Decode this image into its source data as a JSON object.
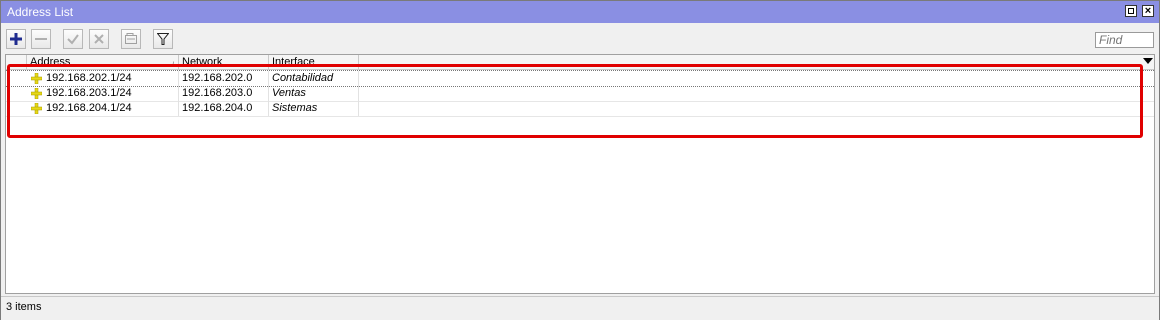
{
  "window": {
    "title": "Address List",
    "controls": [
      "restore-icon",
      "close-icon"
    ]
  },
  "toolbar": {
    "buttons": [
      {
        "name": "add-icon",
        "enabled": true
      },
      {
        "name": "remove-icon",
        "enabled": false
      },
      {
        "name": "enable-icon",
        "enabled": false
      },
      {
        "name": "disable-icon",
        "enabled": false
      },
      {
        "name": "comment-icon",
        "enabled": false
      },
      {
        "name": "filter-icon",
        "enabled": true
      }
    ],
    "find_placeholder": "Find"
  },
  "table": {
    "columns": [
      "Address",
      "Network",
      "Interface"
    ],
    "rows": [
      {
        "address": "192.168.202.1/24",
        "network": "192.168.202.0",
        "interface": "Contabilidad"
      },
      {
        "address": "192.168.203.1/24",
        "network": "192.168.203.0",
        "interface": "Ventas"
      },
      {
        "address": "192.168.204.1/24",
        "network": "192.168.204.0",
        "interface": "Sistemas"
      }
    ]
  },
  "status": {
    "text": "3 items"
  },
  "colors": {
    "titlebar": "#8a8fe3",
    "highlight": "#e00000",
    "add_icon": "#1f2b8f",
    "row_icon": "#e7d817"
  }
}
